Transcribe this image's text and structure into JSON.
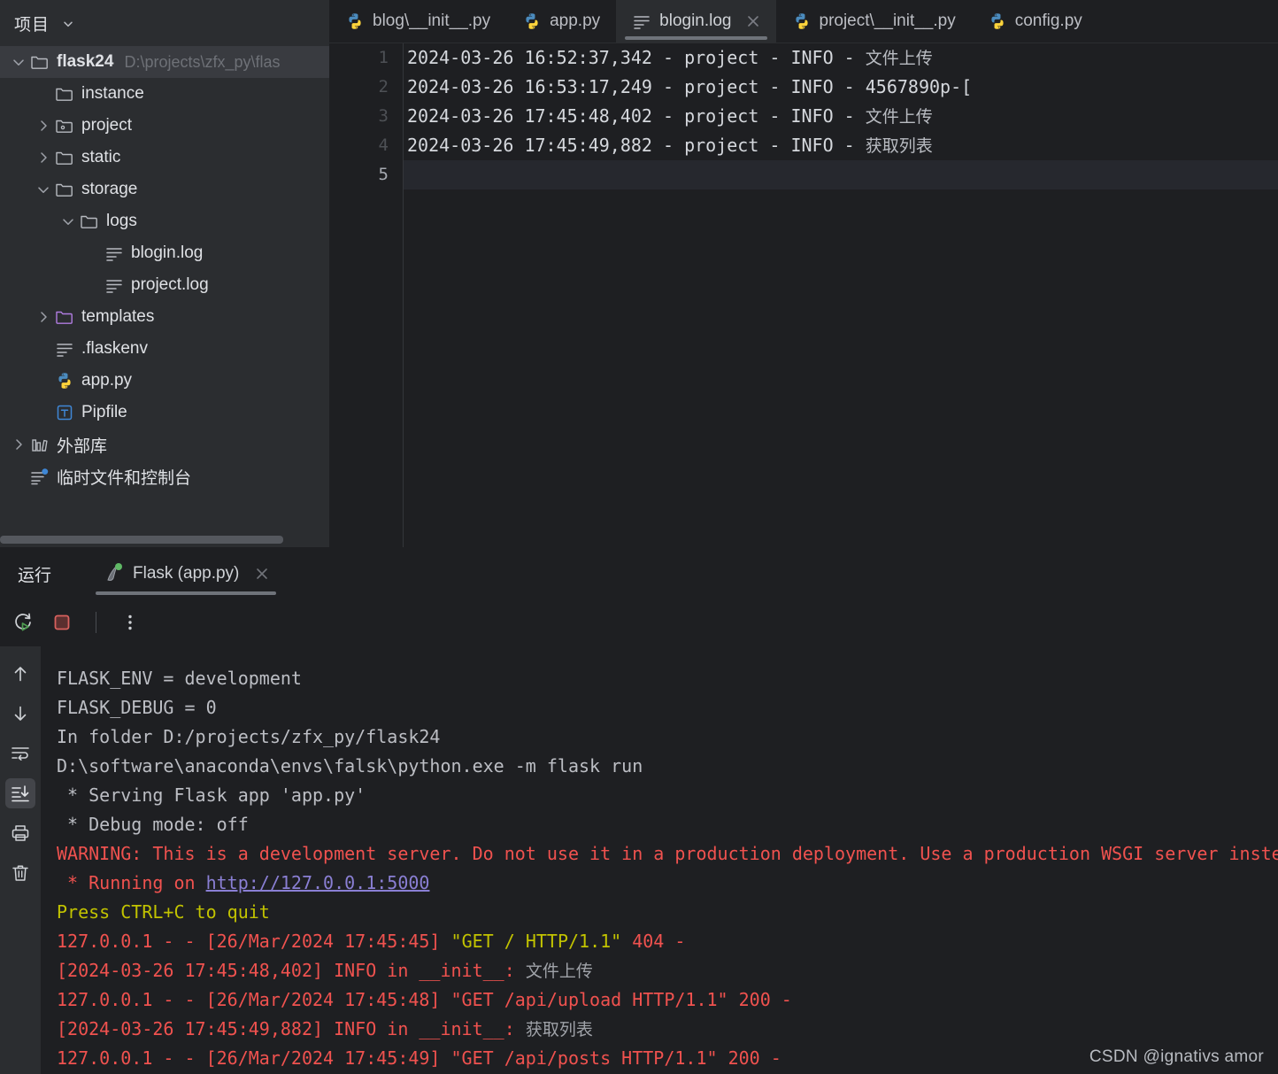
{
  "project_panel": {
    "header_title": "项目",
    "header_chevron": "chevron-down-icon",
    "tree": [
      {
        "depth": 0,
        "twisty": "down",
        "icon": "folder",
        "label": "flask24",
        "bold": true,
        "path": "D:\\projects\\zfx_py\\flas",
        "selected": true
      },
      {
        "depth": 1,
        "twisty": "none",
        "icon": "folder",
        "label": "instance",
        "bold": false,
        "path": "",
        "selected": false
      },
      {
        "depth": 1,
        "twisty": "right",
        "icon": "folder-module",
        "label": "project",
        "bold": false,
        "path": "",
        "selected": false
      },
      {
        "depth": 1,
        "twisty": "right",
        "icon": "folder",
        "label": "static",
        "bold": false,
        "path": "",
        "selected": false
      },
      {
        "depth": 1,
        "twisty": "down",
        "icon": "folder",
        "label": "storage",
        "bold": false,
        "path": "",
        "selected": false
      },
      {
        "depth": 2,
        "twisty": "down",
        "icon": "folder",
        "label": "logs",
        "bold": false,
        "path": "",
        "selected": false
      },
      {
        "depth": 3,
        "twisty": "none",
        "icon": "file-text",
        "label": "blogin.log",
        "bold": false,
        "path": "",
        "selected": false
      },
      {
        "depth": 3,
        "twisty": "none",
        "icon": "file-text",
        "label": "project.log",
        "bold": false,
        "path": "",
        "selected": false
      },
      {
        "depth": 1,
        "twisty": "right",
        "icon": "folder-templates",
        "label": "templates",
        "bold": false,
        "path": "",
        "selected": false
      },
      {
        "depth": 1,
        "twisty": "none",
        "icon": "file-text",
        "label": ".flaskenv",
        "bold": false,
        "path": "",
        "selected": false
      },
      {
        "depth": 1,
        "twisty": "none",
        "icon": "python",
        "label": "app.py",
        "bold": false,
        "path": "",
        "selected": false
      },
      {
        "depth": 1,
        "twisty": "none",
        "icon": "toml",
        "label": "Pipfile",
        "bold": false,
        "path": "",
        "selected": false
      },
      {
        "depth": 0,
        "twisty": "right",
        "icon": "library",
        "label": "外部库",
        "bold": false,
        "path": "",
        "selected": false
      },
      {
        "depth": 0,
        "twisty": "none",
        "icon": "scratches",
        "label": "临时文件和控制台",
        "bold": false,
        "path": "",
        "selected": false
      }
    ]
  },
  "editor": {
    "tabs": [
      {
        "label": "blog\\__init__.py",
        "icon": "python-icon",
        "active": false,
        "closable": false
      },
      {
        "label": "app.py",
        "icon": "python-icon",
        "active": false,
        "closable": false
      },
      {
        "label": "blogin.log",
        "icon": "file-text-icon",
        "active": true,
        "closable": true
      },
      {
        "label": "project\\__init__.py",
        "icon": "python-icon",
        "active": false,
        "closable": false
      },
      {
        "label": "config.py",
        "icon": "python-icon",
        "active": false,
        "closable": false
      }
    ],
    "line_numbers": [
      "1",
      "2",
      "3",
      "4",
      "5"
    ],
    "current_line": 5,
    "lines": [
      {
        "plain": "2024-03-26 16:52:37,342 - project - INFO - ",
        "cjk": "文件上传"
      },
      {
        "plain": "2024-03-26 16:53:17,249 - project - INFO - 4567890p-[",
        "cjk": ""
      },
      {
        "plain": "2024-03-26 17:45:48,402 - project - INFO - ",
        "cjk": "文件上传"
      },
      {
        "plain": "2024-03-26 17:45:49,882 - project - INFO - ",
        "cjk": "获取列表"
      },
      {
        "plain": "",
        "cjk": ""
      }
    ]
  },
  "run_panel": {
    "title": "运行",
    "tab_label": "Flask (app.py)",
    "tab_icon": "flask-icon",
    "tab_status": "running",
    "close_icon": "close-icon",
    "toolbar": [
      {
        "name": "rerun-button",
        "icon": "rerun-icon"
      },
      {
        "name": "stop-button",
        "icon": "stop-icon"
      },
      {
        "name": "more-options-button",
        "icon": "kebab-menu-icon"
      }
    ],
    "rail": [
      {
        "name": "scroll-up-button",
        "icon": "arrow-up-icon",
        "active": false
      },
      {
        "name": "scroll-down-button",
        "icon": "arrow-down-icon",
        "active": false
      },
      {
        "name": "soft-wrap-button",
        "icon": "soft-wrap-icon",
        "active": false
      },
      {
        "name": "scroll-to-end-button",
        "icon": "scroll-to-end-icon",
        "active": true
      },
      {
        "name": "print-button",
        "icon": "printer-icon",
        "active": false
      },
      {
        "name": "clear-all-button",
        "icon": "trash-icon",
        "active": false
      }
    ],
    "console": [
      {
        "segments": [
          {
            "t": "FLASK_ENV = development",
            "c": "plain"
          }
        ]
      },
      {
        "segments": [
          {
            "t": "FLASK_DEBUG = 0",
            "c": "plain"
          }
        ]
      },
      {
        "segments": [
          {
            "t": "In folder D:/projects/zfx_py/flask24",
            "c": "plain"
          }
        ]
      },
      {
        "segments": [
          {
            "t": "D:\\software\\anaconda\\envs\\falsk\\python.exe -m flask run",
            "c": "plain"
          }
        ]
      },
      {
        "segments": [
          {
            "t": " * Serving Flask app 'app.py'",
            "c": "plain"
          }
        ]
      },
      {
        "segments": [
          {
            "t": " * Debug mode: off",
            "c": "plain"
          }
        ]
      },
      {
        "segments": [
          {
            "t": "WARNING: This is a development server. Do not use it in a production deployment. Use a production WSGI server inste",
            "c": "red"
          }
        ]
      },
      {
        "segments": [
          {
            "t": " * Running on ",
            "c": "red"
          },
          {
            "t": "http://127.0.0.1:5000",
            "c": "link"
          }
        ]
      },
      {
        "segments": [
          {
            "t": "Press CTRL+C to quit",
            "c": "yellow"
          }
        ]
      },
      {
        "segments": [
          {
            "t": "127.0.0.1 - - [26/Mar/2024 17:45:45] ",
            "c": "red"
          },
          {
            "t": "\"GET / HTTP/1.1\"",
            "c": "yellow"
          },
          {
            "t": " 404 -",
            "c": "red"
          }
        ]
      },
      {
        "segments": [
          {
            "t": "[2024-03-26 17:45:48,402] INFO in __init__: ",
            "c": "red"
          },
          {
            "t": "文件上传",
            "c": "cjk"
          }
        ]
      },
      {
        "segments": [
          {
            "t": "127.0.0.1 - - [26/Mar/2024 17:45:48] \"GET /api/upload HTTP/1.1\" 200 -",
            "c": "red"
          }
        ]
      },
      {
        "segments": [
          {
            "t": "[2024-03-26 17:45:49,882] INFO in __init__: ",
            "c": "red"
          },
          {
            "t": "获取列表",
            "c": "cjk"
          }
        ]
      },
      {
        "segments": [
          {
            "t": "127.0.0.1 - - [26/Mar/2024 17:45:49] \"GET /api/posts HTTP/1.1\" 200 -",
            "c": "red"
          }
        ]
      }
    ]
  },
  "watermark": "CSDN @ignativs  amor",
  "colors": {
    "panel_bg": "#2b2d30",
    "editor_bg": "#1e1f22",
    "text": "#dfe1e5",
    "muted": "#6e7177",
    "selection": "#393b40",
    "error_red": "#f0524f",
    "warn_yellow": "#c2c300",
    "link_purple": "#8a7fd4",
    "accent_green": "#5fb865"
  }
}
